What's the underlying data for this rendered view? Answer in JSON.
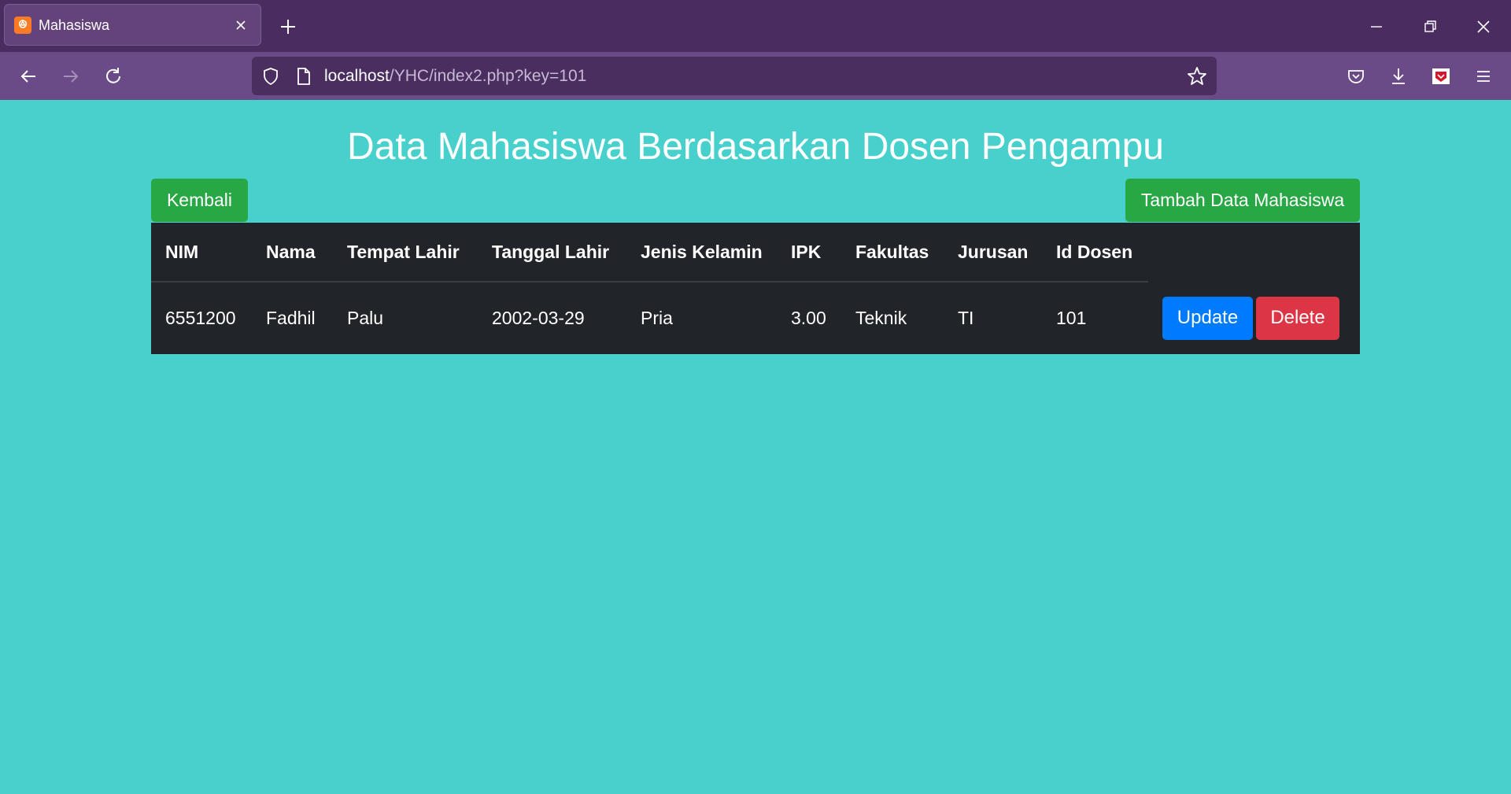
{
  "browser": {
    "tab_title": "Mahasiswa",
    "tab_favicon_glyph": "ꔮ",
    "url_host": "localhost",
    "url_path": "/YHC/index2.php?key=101"
  },
  "page": {
    "title": "Data Mahasiswa Berdasarkan Dosen Pengampu",
    "back_label": "Kembali",
    "add_label": "Tambah Data Mahasiswa"
  },
  "table": {
    "headers": [
      "NIM",
      "Nama",
      "Tempat Lahir",
      "Tanggal Lahir",
      "Jenis Kelamin",
      "IPK",
      "Fakultas",
      "Jurusan",
      "Id Dosen"
    ],
    "rows": [
      {
        "cells": [
          "6551200",
          "Fadhil",
          "Palu",
          "2002-03-29",
          "Pria",
          "3.00",
          "Teknik",
          "TI",
          "101"
        ],
        "update_label": "Update",
        "delete_label": "Delete"
      }
    ]
  },
  "colors": {
    "page_bg": "#48d1cc",
    "success": "#28a745",
    "primary": "#007bff",
    "danger": "#dc3545",
    "table_dark": "#212529"
  }
}
